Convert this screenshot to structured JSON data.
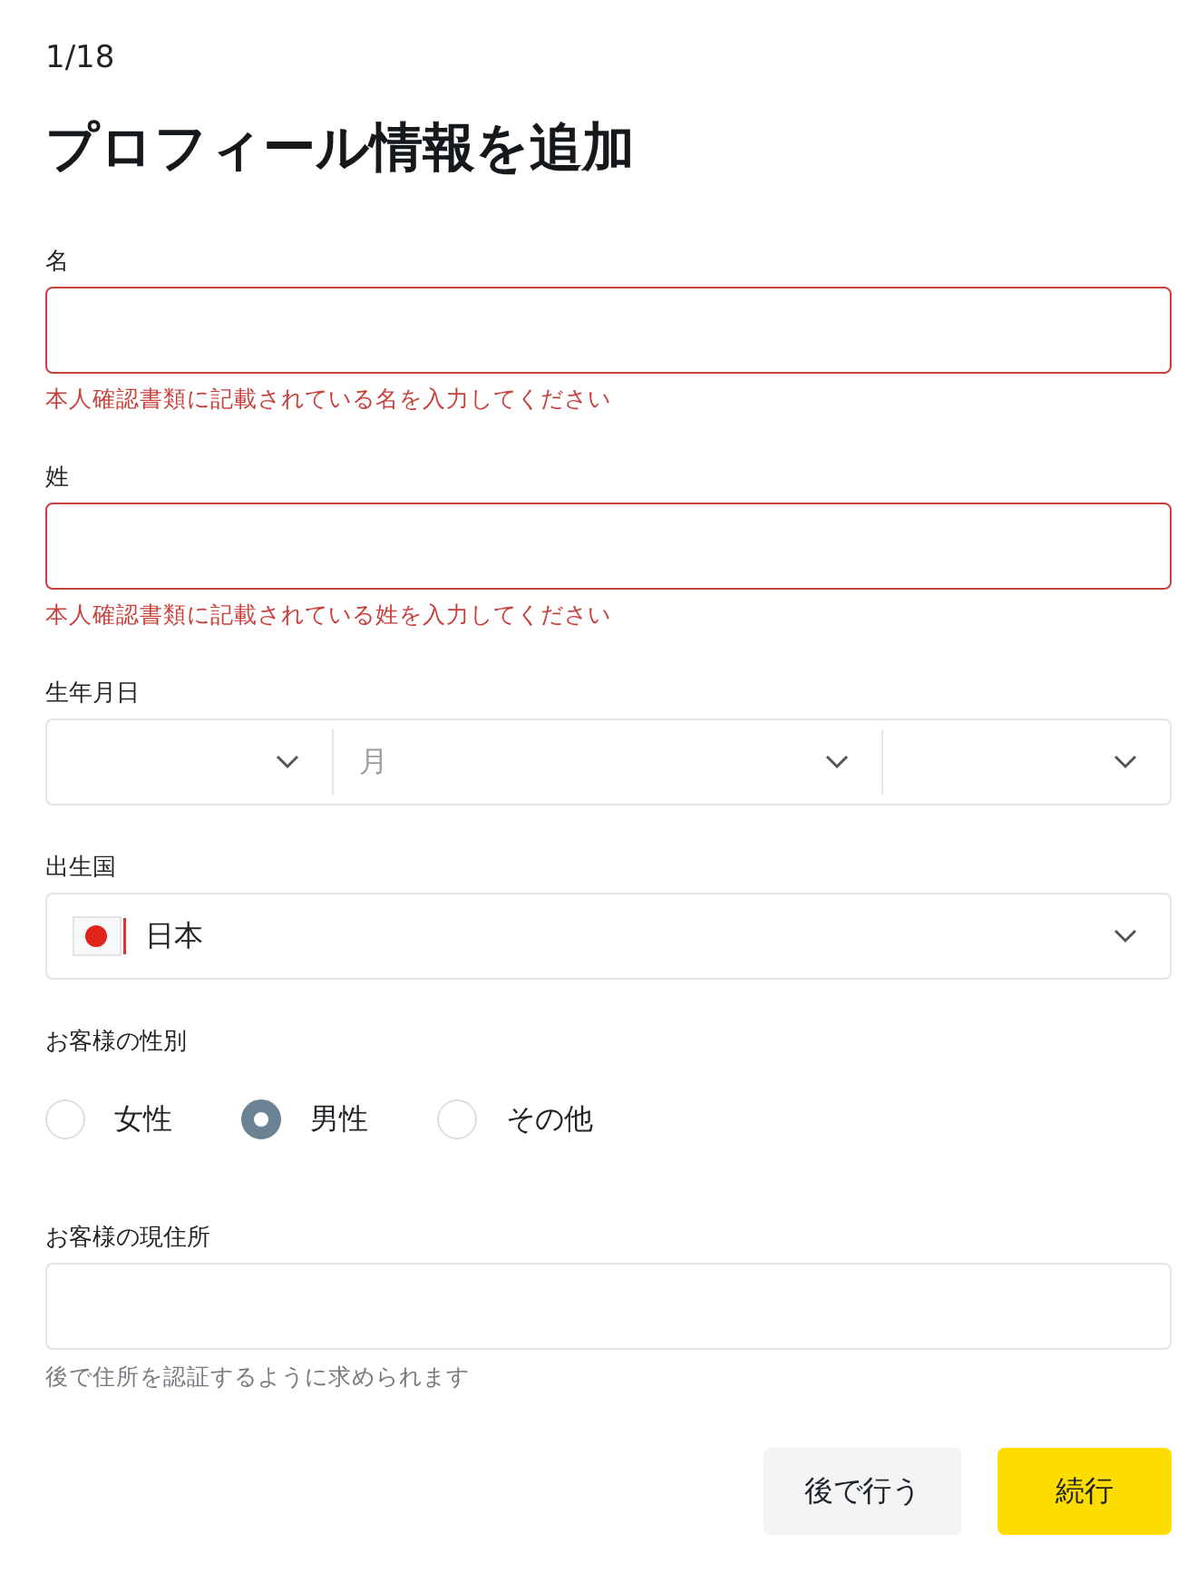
{
  "step": "1/18",
  "title": "プロフィール情報を追加",
  "fields": [
    {
      "kind": "text",
      "label": "名",
      "error": "本人確認書類に記載されている名を入力してください"
    },
    {
      "kind": "text",
      "label": "姓",
      "error": "本人確認書類に記載されている姓を入力してください"
    },
    {
      "kind": "date",
      "label": "生年月日",
      "month_placeholder": "月"
    },
    {
      "kind": "country",
      "label": "出生国",
      "value": "日本"
    },
    {
      "kind": "radio",
      "label": "お客様の性別",
      "options": [
        {
          "label": "女性",
          "selected": false
        },
        {
          "label": "男性",
          "selected": true
        },
        {
          "label": "その他",
          "selected": false
        }
      ]
    },
    {
      "kind": "address",
      "label": "お客様の現住所",
      "hint": "後で住所を認証するように求められます"
    }
  ],
  "buttons": [
    {
      "kind": "secondary",
      "label": "後で行う"
    },
    {
      "kind": "primary",
      "label": "続行"
    }
  ]
}
